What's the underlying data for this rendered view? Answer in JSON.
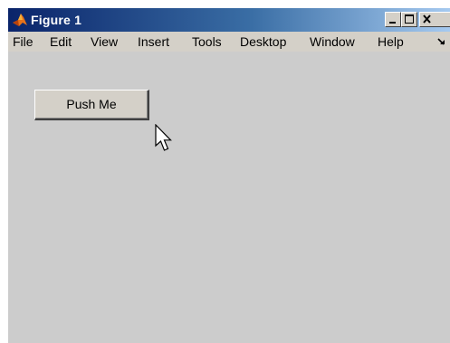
{
  "window": {
    "title": "Figure 1",
    "app_icon": "matlab-icon",
    "controls": {
      "minimize_icon": "minimize-icon",
      "maximize_icon": "maximize-icon",
      "close_icon": "close-icon"
    }
  },
  "menubar": {
    "items": [
      "File",
      "Edit",
      "View",
      "Insert",
      "Tools",
      "Desktop",
      "Window",
      "Help"
    ],
    "overflow_icon": "dock-arrow-icon"
  },
  "figure": {
    "button_label": "Push Me",
    "cursor_icon": "mouse-pointer-icon"
  },
  "colors": {
    "title_gradient_start": "#0a246a",
    "title_gradient_end": "#a6caf0",
    "chrome": "#d4d0c8",
    "figure_background": "#cccccc"
  }
}
